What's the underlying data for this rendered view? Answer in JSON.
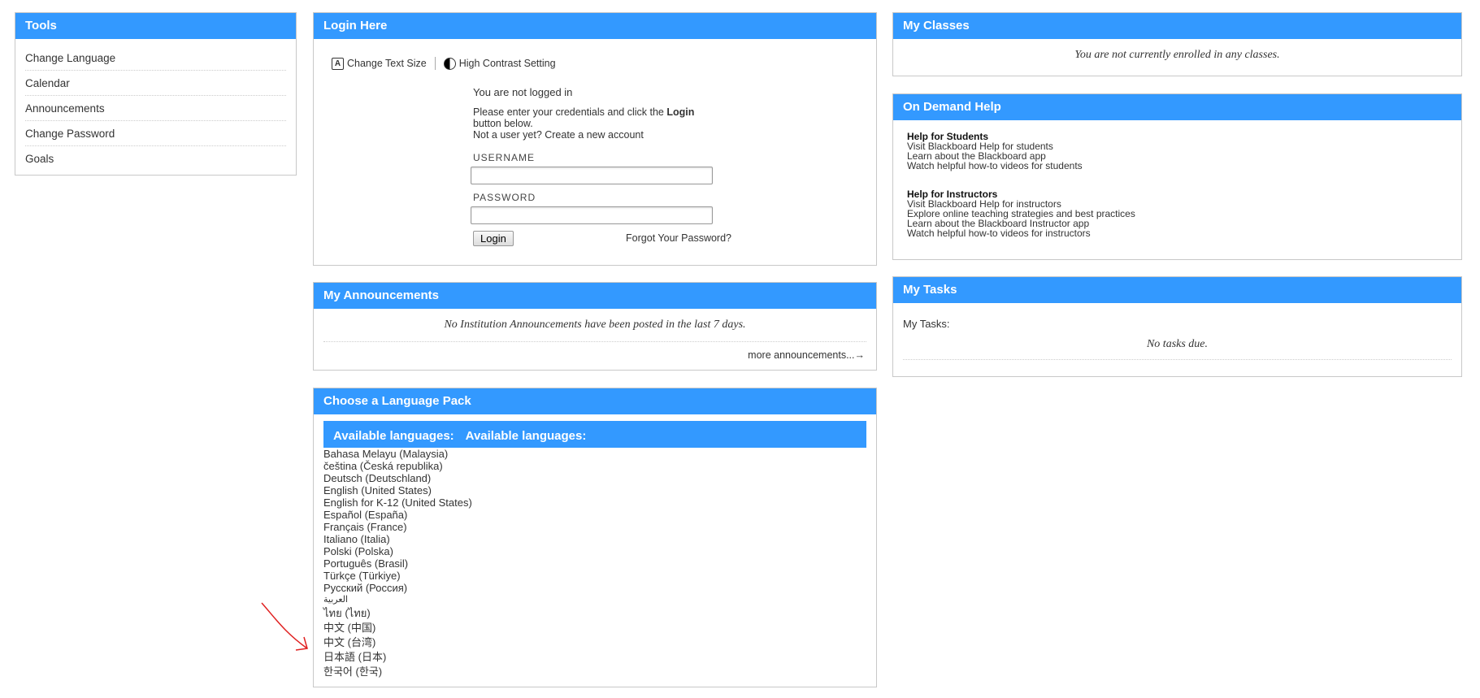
{
  "tools": {
    "title": "Tools",
    "items": [
      "Change Language",
      "Calendar",
      "Announcements",
      "Change Password",
      "Goals"
    ]
  },
  "login": {
    "title": "Login Here",
    "change_text_size": "Change Text Size",
    "high_contrast": "High Contrast Setting",
    "not_logged_in": "You are not logged in",
    "instructions_pre": "Please enter your credentials and click the ",
    "instructions_bold": "Login",
    "instructions_post": "button below.",
    "not_user": "Not a user yet? Create a new account",
    "username_label": "USERNAME",
    "username_value": "",
    "password_label": "PASSWORD",
    "password_value": "",
    "login_button": "Login",
    "forgot": "Forgot Your Password?"
  },
  "announcements": {
    "title": "My Announcements",
    "message": "No Institution Announcements have been posted in the last 7 days.",
    "more": "more announcements...→"
  },
  "language_pack": {
    "title": "Choose a Language Pack",
    "header_1": "Available languages:",
    "header_2": "Available languages:",
    "languages": [
      "Bahasa Melayu (Malaysia)",
      "čeština (Česká republika)",
      "Deutsch (Deutschland)",
      "English (United States)",
      "English for K-12 (United States)",
      "Español (España)",
      "Français (France)",
      "Italiano (Italia)",
      "Polski (Polska)",
      "Português (Brasil)",
      "Türkçe (Türkiye)",
      "Русский (Россия)",
      "العربية",
      "ไทย (ไทย)",
      "中文 (中国)",
      "中文 (台湾)",
      "日本語 (日本)",
      "한국어 (한국)"
    ]
  },
  "classes": {
    "title": "My Classes",
    "message": "You are not currently enrolled in any classes."
  },
  "help": {
    "title": "On Demand Help",
    "students_title": "Help for Students",
    "students_links": [
      "Visit Blackboard Help for students",
      "Learn about the Blackboard app",
      "Watch helpful how-to videos for students"
    ],
    "instructors_title": "Help for Instructors",
    "instructors_links": [
      "Visit Blackboard Help for instructors",
      "Explore online teaching strategies and best practices",
      "Learn about the Blackboard Instructor app",
      "Watch helpful how-to videos for instructors"
    ]
  },
  "tasks": {
    "title": "My Tasks",
    "label": "My Tasks:",
    "message": "No tasks due."
  },
  "colors": {
    "header_blue": "#3399ff",
    "annotation_red": "#e02020"
  }
}
